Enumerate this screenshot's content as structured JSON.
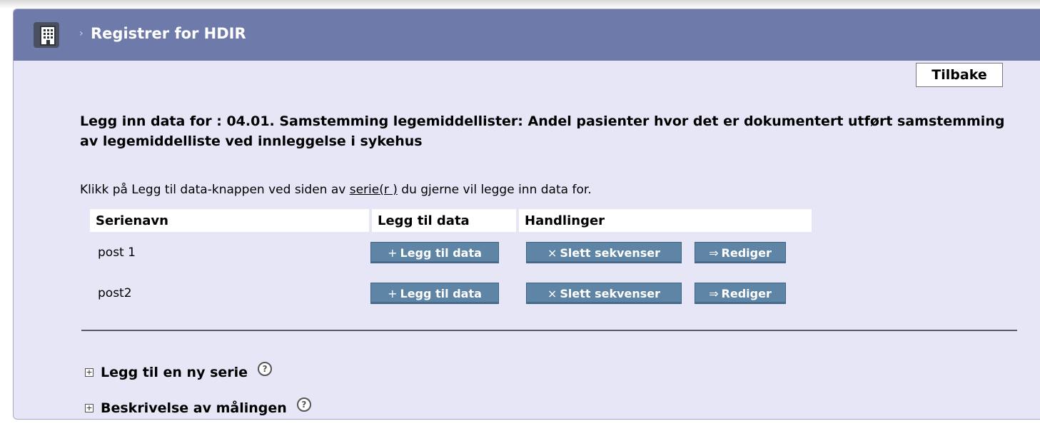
{
  "header": {
    "title": "Registrer for HDIR",
    "icon": "building-icon"
  },
  "back_button": {
    "label": "Tilbake"
  },
  "intro": {
    "title": "Legg inn data for : 04.01. Samstemming legemiddellister: Andel pasienter hvor det er dokumentert utført samstemming av legemiddelliste ved innleggelse i sykehus",
    "instruction_before": "Klikk på Legg til data-knappen ved siden av ",
    "instruction_link": "serie(r )",
    "instruction_after": " du gjerne vil legge inn data for."
  },
  "table": {
    "columns": [
      "Serienavn",
      "Legg til data",
      "Handlinger"
    ],
    "rows": [
      {
        "name": "post 1",
        "add_label": "Legg til data",
        "delete_label": "Slett sekvenser",
        "edit_label": "Rediger"
      },
      {
        "name": "post2",
        "add_label": "Legg til data",
        "delete_label": "Slett sekvenser",
        "edit_label": "Rediger"
      }
    ],
    "icons": {
      "add": "+",
      "delete": "×",
      "edit": "⇒"
    }
  },
  "expanders": [
    {
      "label": "Legg til en ny serie"
    },
    {
      "label": "Beskrivelse av målingen"
    }
  ],
  "help_glyph": "?",
  "colors": {
    "header_bg": "#6d7aaa",
    "panel_bg": "#e6e6f7",
    "button_bg": "#5e84a6"
  }
}
